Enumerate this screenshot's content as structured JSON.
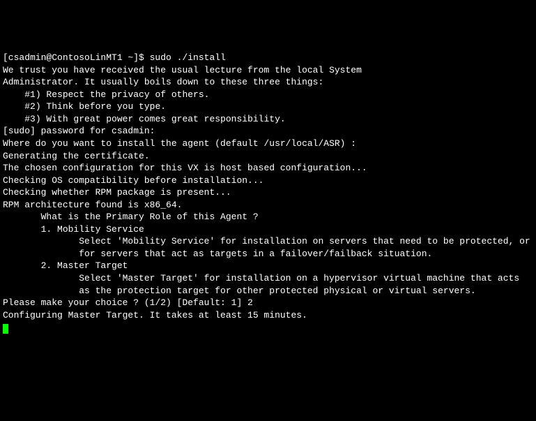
{
  "prompt": "[csadmin@ContosoLinMT1 ~]$ sudo ./install",
  "lines": [
    "",
    "We trust you have received the usual lecture from the local System",
    "Administrator. It usually boils down to these three things:",
    "",
    "    #1) Respect the privacy of others.",
    "    #2) Think before you type.",
    "    #3) With great power comes great responsibility.",
    "",
    "[sudo] password for csadmin:",
    "",
    "Where do you want to install the agent (default /usr/local/ASR) :",
    "",
    "Generating the certificate.",
    "",
    "The chosen configuration for this VX is host based configuration...",
    "Checking OS compatibility before installation...",
    "",
    "Checking whether RPM package is present...",
    "RPM architecture found is x86_64.",
    "",
    "",
    "       What is the Primary Role of this Agent ?",
    "",
    "       1. Mobility Service",
    "",
    "              Select 'Mobility Service' for installation on servers that need to be protected, or",
    "              for servers that act as targets in a failover/failback situation.",
    "",
    "       2. Master Target",
    "",
    "              Select 'Master Target' for installation on a hypervisor virtual machine that acts",
    "              as the protection target for other protected physical or virtual servers.",
    "",
    "Please make your choice ? (1/2) [Default: 1] 2",
    "Configuring Master Target. It takes at least 15 minutes."
  ]
}
